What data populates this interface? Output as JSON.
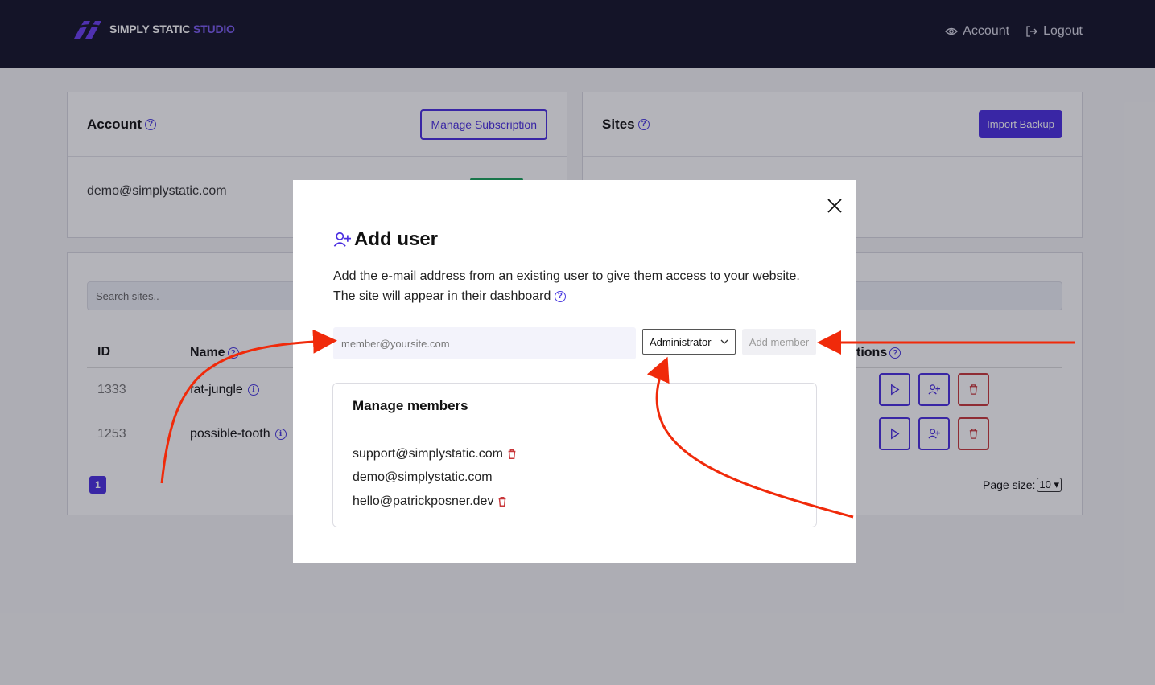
{
  "header": {
    "logo_main": "SIMPLY STATIC",
    "logo_accent": "STUDIO",
    "nav": [
      {
        "label": "Account",
        "icon": "eye-icon"
      },
      {
        "label": "Logout",
        "icon": "logout-icon"
      }
    ]
  },
  "account_card": {
    "title": "Account",
    "button": "Manage Subscription",
    "email": "demo@simplystatic.com"
  },
  "sites_card": {
    "title": "Sites",
    "button": "Import Backup"
  },
  "table": {
    "search_placeholder": "Search sites..",
    "columns": {
      "id": "ID",
      "name": "Name",
      "actions": "tions"
    },
    "rows": [
      {
        "id": "1333",
        "name": "fat-jungle"
      },
      {
        "id": "1253",
        "name": "possible-tooth"
      }
    ],
    "current_page": "1",
    "page_size_label": "Page size:",
    "page_size_value": "10"
  },
  "modal": {
    "title": "Add user",
    "description": "Add the e-mail address from an existing user to give them access to your website. The site will appear in their dashboard",
    "input_placeholder": "member@yoursite.com",
    "role_value": "Administrator",
    "add_button": "Add member",
    "members_title": "Manage members",
    "members": [
      {
        "email": "support@simplystatic.com",
        "deletable": true
      },
      {
        "email": "demo@simplystatic.com",
        "deletable": false
      },
      {
        "email": "hello@patrickposner.dev",
        "deletable": true
      }
    ]
  },
  "colors": {
    "brand": "#4a2ee0",
    "header_bg": "#141428",
    "danger": "#c9373a",
    "arrow": "#f02a0a"
  }
}
